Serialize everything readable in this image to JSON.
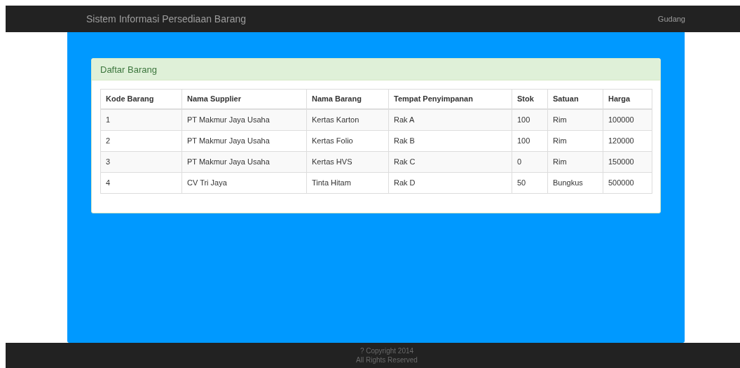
{
  "navbar": {
    "brand": "Sistem Informasi Persediaan Barang",
    "user": "Gudang"
  },
  "panel": {
    "title": "Daftar Barang",
    "table": {
      "columns": [
        "Kode Barang",
        "Nama Supplier",
        "Nama Barang",
        "Tempat Penyimpanan",
        "Stok",
        "Satuan",
        "Harga"
      ],
      "rows": [
        [
          "1",
          "PT Makmur Jaya Usaha",
          "Kertas Karton",
          "Rak A",
          "100",
          "Rim",
          "100000"
        ],
        [
          "2",
          "PT Makmur Jaya Usaha",
          "Kertas Folio",
          "Rak B",
          "100",
          "Rim",
          "120000"
        ],
        [
          "3",
          "PT Makmur Jaya Usaha",
          "Kertas HVS",
          "Rak C",
          "0",
          "Rim",
          "150000"
        ],
        [
          "4",
          "CV Tri Jaya",
          "Tinta Hitam",
          "Rak D",
          "50",
          "Bungkus",
          "500000"
        ]
      ]
    }
  },
  "footer": {
    "lines": [
      "? Copyright 2014",
      "All Rights Reserved"
    ]
  }
}
